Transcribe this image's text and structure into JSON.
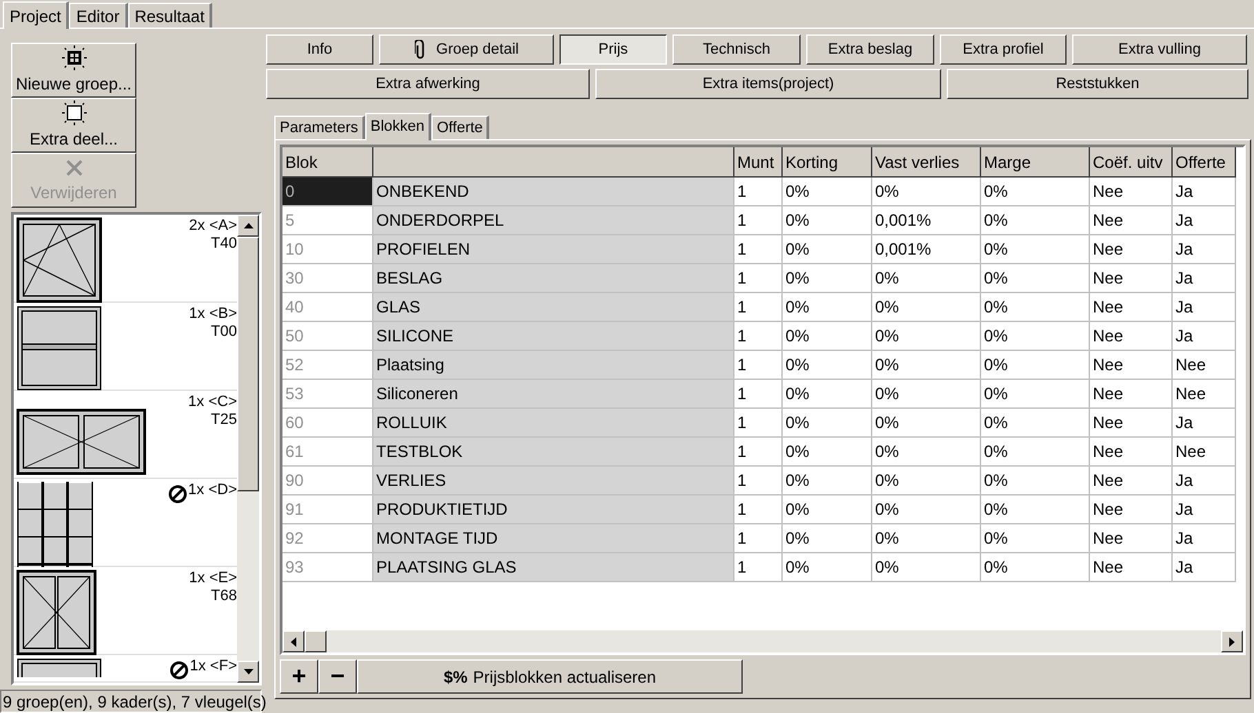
{
  "main_tabs": [
    {
      "label": "Project",
      "selected": true
    },
    {
      "label": "Editor",
      "selected": false
    },
    {
      "label": "Resultaat",
      "selected": false
    }
  ],
  "side_buttons": [
    {
      "label": "Nieuwe groep...",
      "kind": "group",
      "disabled": false
    },
    {
      "label": "Extra deel...",
      "kind": "part",
      "disabled": false
    },
    {
      "label": "Verwijderen",
      "kind": "delete",
      "disabled": true
    }
  ],
  "groups": [
    {
      "kind": "turn-tilt",
      "count": "2x <A>",
      "code": "T40",
      "blocked": false
    },
    {
      "kind": "transom",
      "count": "1x <B>",
      "code": "T00",
      "blocked": false
    },
    {
      "kind": "double",
      "count": "1x <C>",
      "code": "T25",
      "blocked": false
    },
    {
      "kind": "grid",
      "count": "1x <D>",
      "blocked": true
    },
    {
      "kind": "double-door",
      "count": "1x <E>",
      "code": "T68",
      "blocked": false
    },
    {
      "kind": "frame",
      "count": "1x <F>",
      "blocked": true
    }
  ],
  "status_bar": "9 groep(en), 9 kader(s), 7 vleugel(s)",
  "toolbar_row_1": [
    {
      "label": "Info",
      "kind": "text",
      "selected": false
    },
    {
      "label": "Groep detail",
      "kind": "attachment",
      "selected": false
    },
    {
      "label": "Prijs",
      "kind": "text",
      "selected": true
    },
    {
      "label": "Technisch",
      "kind": "text",
      "selected": false
    },
    {
      "label": "Extra beslag",
      "kind": "text",
      "selected": false
    },
    {
      "label": "Extra profiel",
      "kind": "text",
      "selected": false
    },
    {
      "label": "Extra vulling",
      "kind": "text",
      "selected": false
    }
  ],
  "toolbar_row_2": [
    {
      "label": "Extra afwerking",
      "selected": false
    },
    {
      "label": "Extra items(project)",
      "selected": false
    },
    {
      "label": "Reststukken",
      "selected": false
    }
  ],
  "sub_tabs": [
    {
      "label": "Parameters",
      "selected": false
    },
    {
      "label": "Blokken",
      "selected": true
    },
    {
      "label": "Offerte",
      "selected": false
    }
  ],
  "table": {
    "columns": [
      "Blok",
      "Munt",
      "Korting",
      "Vast verlies",
      "Marge",
      "Coëf. uitv",
      "Offerte"
    ],
    "rows": [
      {
        "blok": "0",
        "name": "ONBEKEND",
        "munt": "1",
        "korting": "0%",
        "vast_verlies": "0%",
        "marge": "0%",
        "coef": "Nee",
        "offerte": "Ja",
        "selected": true
      },
      {
        "blok": "5",
        "name": "ONDERDORPEL",
        "munt": "1",
        "korting": "0%",
        "vast_verlies": "0,001%",
        "marge": "0%",
        "coef": "Nee",
        "offerte": "Ja",
        "selected": false
      },
      {
        "blok": "10",
        "name": "PROFIELEN",
        "munt": "1",
        "korting": "0%",
        "vast_verlies": "0,001%",
        "marge": "0%",
        "coef": "Nee",
        "offerte": "Ja",
        "selected": false
      },
      {
        "blok": "30",
        "name": "BESLAG",
        "munt": "1",
        "korting": "0%",
        "vast_verlies": "0%",
        "marge": "0%",
        "coef": "Nee",
        "offerte": "Ja",
        "selected": false
      },
      {
        "blok": "40",
        "name": "GLAS",
        "munt": "1",
        "korting": "0%",
        "vast_verlies": "0%",
        "marge": "0%",
        "coef": "Nee",
        "offerte": "Ja",
        "selected": false
      },
      {
        "blok": "50",
        "name": "SILICONE",
        "munt": "1",
        "korting": "0%",
        "vast_verlies": "0%",
        "marge": "0%",
        "coef": "Nee",
        "offerte": "Ja",
        "selected": false
      },
      {
        "blok": "52",
        "name": "Plaatsing",
        "munt": "1",
        "korting": "0%",
        "vast_verlies": "0%",
        "marge": "0%",
        "coef": "Nee",
        "offerte": "Nee",
        "selected": false
      },
      {
        "blok": "53",
        "name": "Siliconeren",
        "munt": "1",
        "korting": "0%",
        "vast_verlies": "0%",
        "marge": "0%",
        "coef": "Nee",
        "offerte": "Nee",
        "selected": false
      },
      {
        "blok": "60",
        "name": "ROLLUIK",
        "munt": "1",
        "korting": "0%",
        "vast_verlies": "0%",
        "marge": "0%",
        "coef": "Nee",
        "offerte": "Ja",
        "selected": false
      },
      {
        "blok": "61",
        "name": "TESTBLOK",
        "munt": "1",
        "korting": "0%",
        "vast_verlies": "0%",
        "marge": "0%",
        "coef": "Nee",
        "offerte": "Nee",
        "selected": false
      },
      {
        "blok": "90",
        "name": "VERLIES",
        "munt": "1",
        "korting": "0%",
        "vast_verlies": "0%",
        "marge": "0%",
        "coef": "Nee",
        "offerte": "Ja",
        "selected": false
      },
      {
        "blok": "91",
        "name": "PRODUKTIETIJD",
        "munt": "1",
        "korting": "0%",
        "vast_verlies": "0%",
        "marge": "0%",
        "coef": "Nee",
        "offerte": "Ja",
        "selected": false
      },
      {
        "blok": "92",
        "name": "MONTAGE TIJD",
        "munt": "1",
        "korting": "0%",
        "vast_verlies": "0%",
        "marge": "0%",
        "coef": "Nee",
        "offerte": "Ja",
        "selected": false
      },
      {
        "blok": "93",
        "name": "PLAATSING GLAS",
        "munt": "1",
        "korting": "0%",
        "vast_verlies": "0%",
        "marge": "0%",
        "coef": "Nee",
        "offerte": "Ja",
        "selected": false
      }
    ]
  },
  "bottom_buttons": [
    {
      "kind": "add",
      "label": "+"
    },
    {
      "kind": "remove",
      "label": "−"
    },
    {
      "kind": "update",
      "label": "Prijsblokken actualiseren",
      "icon_text": "$%"
    }
  ]
}
